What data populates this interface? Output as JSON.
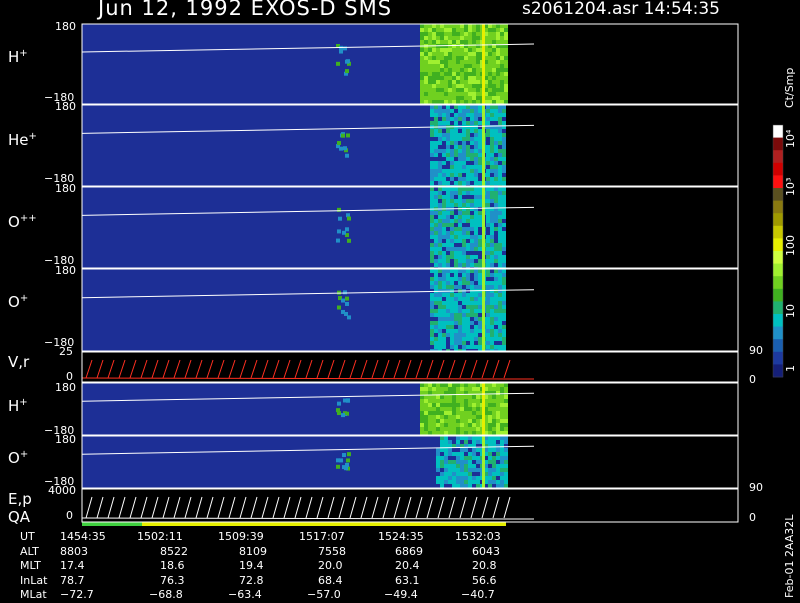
{
  "header": {
    "title": "Jun 12, 1992    EXOS-D SMS",
    "file": "s2061204.asr  14:54:35"
  },
  "panels": [
    {
      "label": "H",
      "sup": "+",
      "ymax": "180",
      "ymin": "−180"
    },
    {
      "label": "He",
      "sup": "+",
      "ymax": "180",
      "ymin": "−180"
    },
    {
      "label": "O",
      "sup": "++",
      "ymax": "180",
      "ymin": "−180"
    },
    {
      "label": "O",
      "sup": "+",
      "ymax": "180",
      "ymin": "−180"
    },
    {
      "label": "V,r",
      "sup": "",
      "ymax": "25",
      "ymin": "0",
      "rmax": "90",
      "rmin": "0"
    },
    {
      "label": "H",
      "sup": "+",
      "ymax": "180",
      "ymin": "−180"
    },
    {
      "label": "O",
      "sup": "+",
      "ymax": "180",
      "ymin": "−180"
    },
    {
      "label": "E,p",
      "label2": "QA",
      "sup": "",
      "ymax": "4000",
      "ymin": "0",
      "rmax": "90",
      "rmin": "0"
    }
  ],
  "colorbar": {
    "unit": "Ct/Smp",
    "ticks": [
      "10⁴",
      "10³",
      "100",
      "10",
      "1"
    ],
    "colors": [
      "#ffffff",
      "#7a0a0a",
      "#b02020",
      "#d00000",
      "#ff1010",
      "#5a5020",
      "#8a7a10",
      "#a09a00",
      "#c8c800",
      "#e6ef00",
      "#d0ff40",
      "#a0f030",
      "#70d020",
      "#40b020",
      "#20b070",
      "#00c0c0",
      "#2090c8",
      "#1a5fb0",
      "#1d3aa0",
      "#151f78"
    ]
  },
  "footer": {
    "rows": [
      {
        "name": "UT",
        "values": [
          "1454:35",
          "1502:11",
          "1509:39",
          "1517:07",
          "1524:35",
          "1532:03"
        ]
      },
      {
        "name": "ALT",
        "values": [
          "8803",
          "8522",
          "8109",
          "7558",
          "6869",
          "6043"
        ]
      },
      {
        "name": "MLT",
        "values": [
          "17.4",
          "18.6",
          "19.4",
          "20.0",
          "20.4",
          "20.8"
        ]
      },
      {
        "name": "InLat",
        "values": [
          "78.7",
          "76.3",
          "72.8",
          "68.4",
          "63.1",
          "56.6"
        ]
      },
      {
        "name": "MLat",
        "values": [
          "−72.7",
          "−68.8",
          "−63.4",
          "−57.0",
          "−49.4",
          "−40.7"
        ]
      }
    ],
    "stamp": "Feb-01 2AA32L"
  },
  "chart_data": {
    "type": "heatmap",
    "title": "Jun 12, 1992    EXOS-D SMS",
    "x": [
      "1454:35",
      "1502:11",
      "1509:39",
      "1517:07",
      "1524:35",
      "1532:03"
    ],
    "panels": [
      {
        "name": "H+",
        "ylim": [
          -180,
          180
        ]
      },
      {
        "name": "He+",
        "ylim": [
          -180,
          180
        ]
      },
      {
        "name": "O++",
        "ylim": [
          -180,
          180
        ]
      },
      {
        "name": "O+",
        "ylim": [
          -180,
          180
        ]
      },
      {
        "name": "V,r",
        "ylim": [
          0,
          25
        ],
        "y2lim": [
          0,
          90
        ]
      },
      {
        "name": "H+",
        "ylim": [
          -180,
          180
        ]
      },
      {
        "name": "O+",
        "ylim": [
          -180,
          180
        ]
      },
      {
        "name": "E,p QA",
        "ylim": [
          0,
          4000
        ],
        "y2lim": [
          0,
          90
        ]
      }
    ],
    "colorbar": {
      "label": "Ct/Smp",
      "scale": "log",
      "ticks": [
        "1",
        "10",
        "100",
        "10³",
        "10⁴"
      ]
    },
    "grid": false,
    "legend": "right"
  }
}
